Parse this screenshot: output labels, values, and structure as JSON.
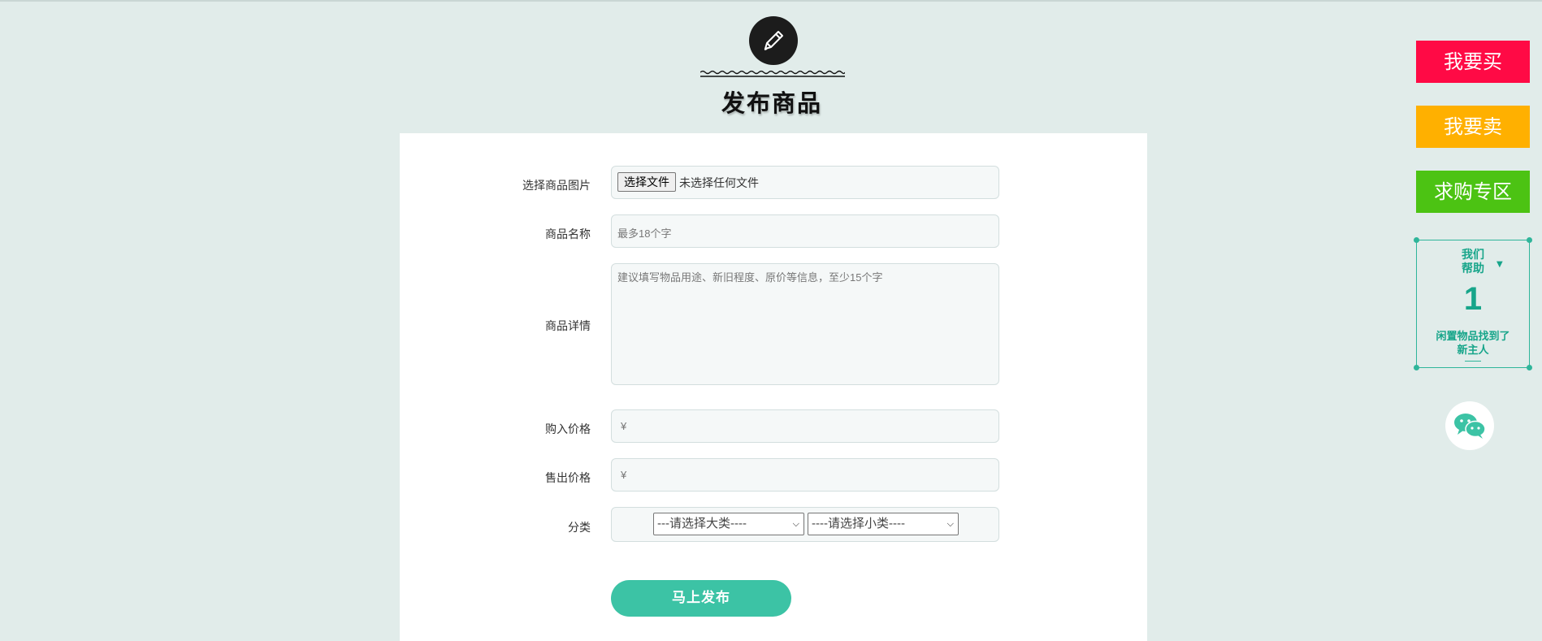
{
  "header": {
    "title": "发布商品",
    "icon": "pencil-icon"
  },
  "form": {
    "image": {
      "label": "选择商品图片",
      "button_label": "选择文件",
      "status": "未选择任何文件"
    },
    "name": {
      "label": "商品名称",
      "placeholder": "最多18个字"
    },
    "detail": {
      "label": "商品详情",
      "placeholder": "建议填写物品用途、新旧程度、原价等信息，至少15个字"
    },
    "buy_price": {
      "label": "购入价格",
      "prefix": "¥"
    },
    "sell_price": {
      "label": "售出价格",
      "prefix": "¥"
    },
    "category": {
      "label": "分类",
      "major_selected": "---请选择大类----",
      "minor_selected": "----请选择小类----"
    },
    "submit_label": "马上发布"
  },
  "sidebar": {
    "buy_label": "我要买",
    "sell_label": "我要卖",
    "request_label": "求购专区",
    "help": {
      "line1": "我们",
      "line2": "帮助",
      "count": "1",
      "caption1": "闲置物品找到了",
      "caption2": "新主人"
    },
    "wechat_icon": "wechat-icon"
  },
  "colors": {
    "background": "#e1ecea",
    "accent": "#3cc3a5",
    "buy": "#ff0a45",
    "sell": "#ffb000",
    "request": "#4cc313"
  }
}
